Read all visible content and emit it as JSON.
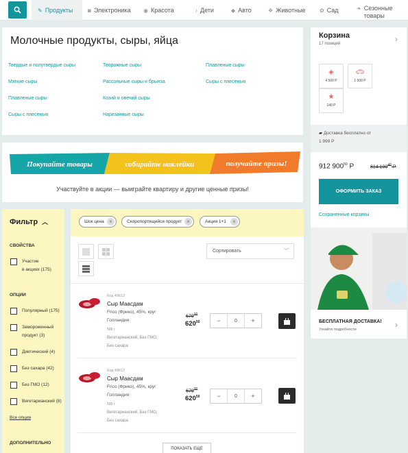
{
  "nav": {
    "items": [
      {
        "label": "Продукты",
        "icon": "carrot-icon"
      },
      {
        "label": "Электроника",
        "icon": "camera-icon"
      },
      {
        "label": "Красота",
        "icon": "beauty-icon"
      },
      {
        "label": "Дети",
        "icon": "rattle-icon"
      },
      {
        "label": "Авто",
        "icon": "car-icon"
      },
      {
        "label": "Животные",
        "icon": "paw-icon"
      },
      {
        "label": "Сад",
        "icon": "flower-icon"
      },
      {
        "label": "Сезонные",
        "label2": "товары",
        "icon": "leaf-icon"
      }
    ],
    "active_index": 0,
    "accent": "#13959b"
  },
  "category": {
    "title": "Молочные продукты, сыры, яйца",
    "links": [
      "Твердые и полутвердые сыры",
      "Творожные сыры",
      "Плавленые сыры",
      "Мягкие сыры",
      "Рассольные сыры и брынза",
      "Сыры с плесенью",
      "Плавленые сыры",
      "Козий и овечий сыры",
      "Сыры с плесенью",
      "Нарезанные сыры"
    ]
  },
  "promo": {
    "parts": [
      "Покупайте товары",
      "собирайте наклейки",
      "получайте призы!"
    ],
    "caption": "Участвуйте в акции — выиграйте квартиру и другие ценные призы!"
  },
  "filter": {
    "title": "Фильтр",
    "sections": [
      {
        "heading": "СВОЙСТВА",
        "options": [
          {
            "label": "Участие",
            "label2": "в акциях (175)"
          }
        ]
      },
      {
        "heading": "ОПЦИИ",
        "options": [
          {
            "label": "Популярный (175)"
          },
          {
            "label": "Замороженный",
            "label2": "продукт (3)"
          },
          {
            "label": "Диетический (4)"
          },
          {
            "label": "Без сахара (42)"
          },
          {
            "label": "Без ГМО (12)"
          },
          {
            "label": "Вегетарианский (8)"
          }
        ]
      }
    ],
    "all_options": "Все опции",
    "more_heading": "ДОПОЛНИТЕЛЬНО"
  },
  "chips": [
    "Шок цена",
    "Скоропортящийся продукт",
    "Акция 1+1"
  ],
  "sort": {
    "label": "Сортировать"
  },
  "products": [
    {
      "code": "Код 49612",
      "name": "Сыр Маасдам",
      "desc1": "Frico (Фрико), 45%, круг",
      "desc2": "Голландия",
      "weight": "500 г",
      "tags1": "Вегетарианский, Без ГМО,",
      "tags2": "Без сахара",
      "old_price": "679",
      "old_cents": "00",
      "price": "620",
      "cents": "50",
      "qty": "0"
    },
    {
      "code": "Код 49612",
      "name": "Сыр Маасдам",
      "desc1": "Frico (Фрико), 45%, круг",
      "desc2": "Голландия",
      "weight": "500 г",
      "tags1": "Вегетарианский, Без ГМО,",
      "tags2": "Без сахара",
      "old_price": "679",
      "old_cents": "00",
      "price": "620",
      "cents": "50",
      "qty": "0"
    }
  ],
  "more_button": "ПОКАЗАТЬ ЕЩЕ",
  "basket": {
    "title": "Корзина",
    "count": "17 позиций",
    "tiles": [
      {
        "icon": "tag-icon",
        "value": "4 500 Р"
      },
      {
        "icon": "car-icon",
        "value": "1 500 Р"
      },
      {
        "icon": "star-icon",
        "value": "140 Р"
      }
    ],
    "delivery_line1": "Доставка бесплатно от",
    "delivery_line2": "1 999 Р",
    "total": "912 900",
    "total_cents": "50",
    "total_currency": "Р",
    "total_old": "814 100",
    "total_old_cents": "40",
    "total_old_currency": "Р",
    "order_button": "ОФОРМИТЬ ЗАКАЗ",
    "saved_link": "Сохраненные корзины"
  },
  "free_delivery": {
    "title": "БЕСПЛАТНАЯ ДОСТАВКА!",
    "subtitle": "Узнайте подробности"
  }
}
